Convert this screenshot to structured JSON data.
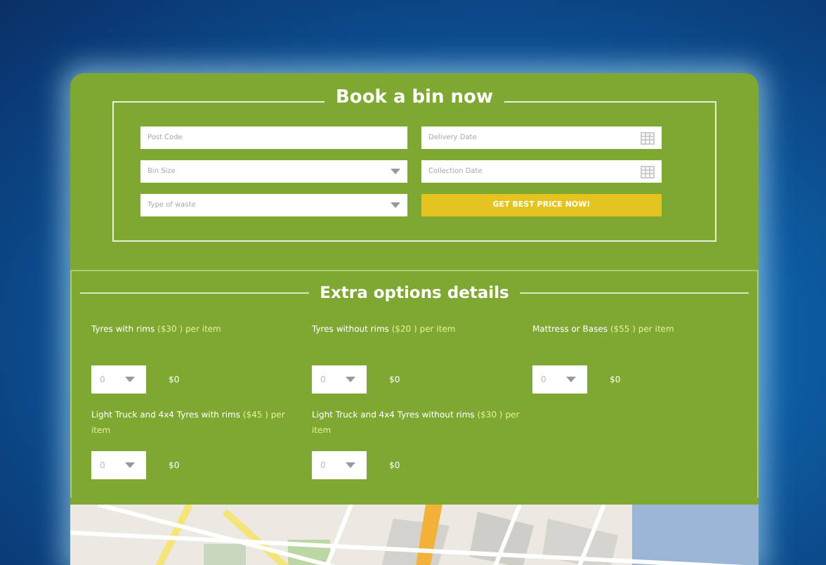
{
  "booking": {
    "title": "Book a bin now",
    "fields": [
      {
        "kind": "text",
        "placeholder": "Post Code"
      },
      {
        "kind": "date",
        "placeholder": "Delivery Date"
      },
      {
        "kind": "select",
        "placeholder": "Bin Size"
      },
      {
        "kind": "date",
        "placeholder": "Collection Date"
      },
      {
        "kind": "select",
        "placeholder": "Type of waste"
      },
      {
        "kind": "button",
        "label": "GET BEST PRICE NOW!"
      }
    ]
  },
  "extras": {
    "title": "Extra options details",
    "options": [
      {
        "label": "Tyres with rims",
        "price": "($30 )",
        "unit": "per item",
        "quantity": "0",
        "total": "$0"
      },
      {
        "label": "Tyres without rims",
        "price": "($20 )",
        "unit": "per item",
        "quantity": "0",
        "total": "$0"
      },
      {
        "label": "Mattress or Bases",
        "price": "($55 )",
        "unit": "per item",
        "quantity": "0",
        "total": "$0"
      },
      {
        "label": "Light Truck and 4x4 Tyres with rims",
        "price": "($45 )",
        "unit": "per item",
        "quantity": "0",
        "total": "$0"
      },
      {
        "label": "Light Truck and 4x4 Tyres without rims",
        "price": "($30 )",
        "unit": "per item",
        "quantity": "0",
        "total": "$0"
      }
    ]
  }
}
